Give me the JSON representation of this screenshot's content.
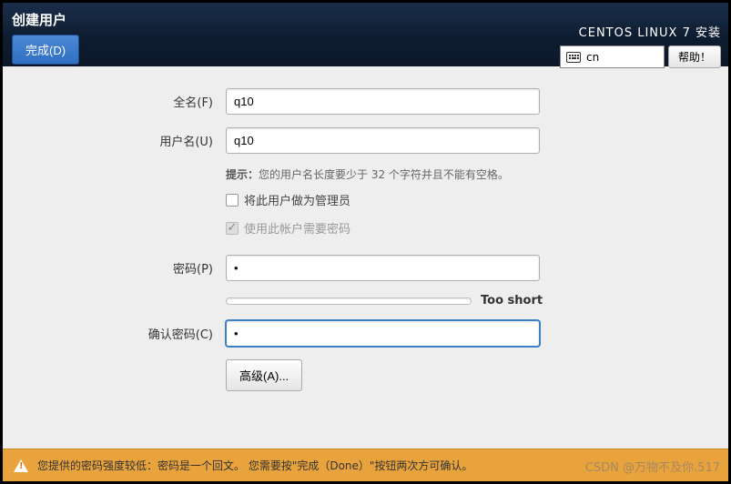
{
  "header": {
    "title": "创建用户",
    "done_button": "完成(D)",
    "installer_label": "CENTOS LINUX 7 安装",
    "keyboard_layout": "cn",
    "help_button": "帮助！"
  },
  "form": {
    "fullname": {
      "label": "全名(F)",
      "value": "q10"
    },
    "username": {
      "label": "用户名(U)",
      "value": "q10",
      "hint_prefix": "提示：",
      "hint_text": "您的用户名长度要少于 32 个字符并且不能有空格。"
    },
    "make_admin": {
      "checked": false,
      "label": "将此用户做为管理员"
    },
    "require_password": {
      "checked": true,
      "disabled": true,
      "label": "使用此帐户需要密码"
    },
    "password": {
      "label": "密码(P)",
      "value": "•"
    },
    "strength": {
      "label": "Too short"
    },
    "confirm": {
      "label": "确认密码(C)",
      "value": "•"
    },
    "advanced_button": "高级(A)..."
  },
  "warning": {
    "text": "您提供的密码强度较低：密码是一个回文。 您需要按\"完成（Done）\"按钮两次方可确认。"
  },
  "watermark": "CSDN @万物不及你.517"
}
